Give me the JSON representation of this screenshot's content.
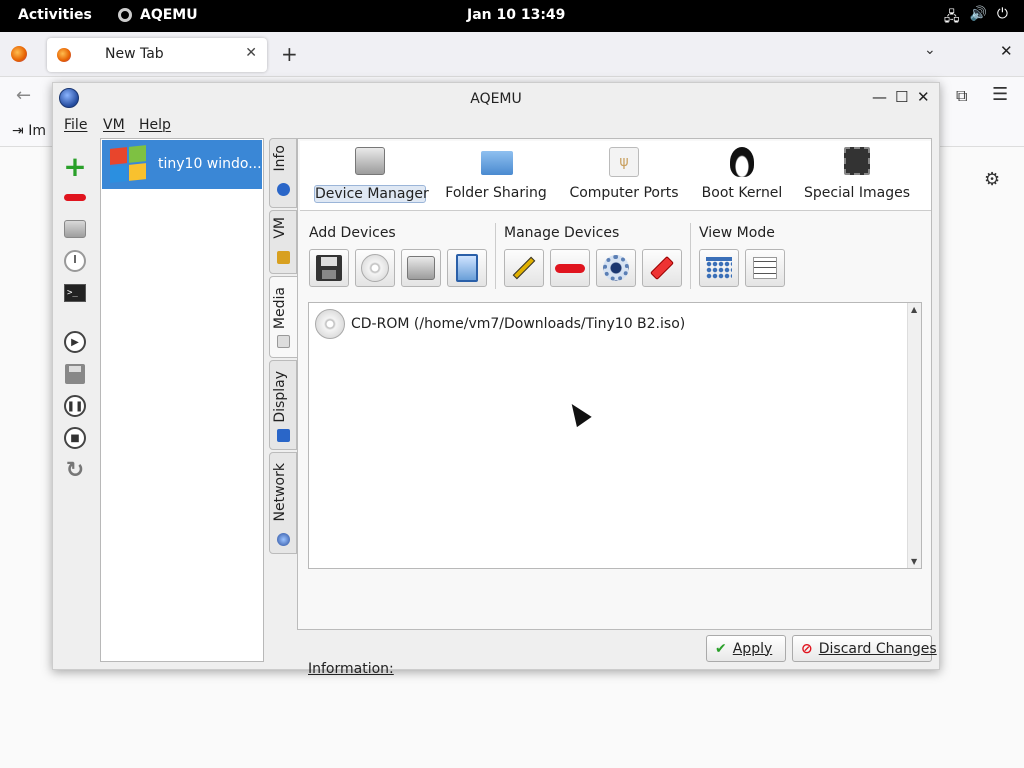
{
  "topbar": {
    "activities": "Activities",
    "app_name": "AQEMU",
    "clock": "Jan 10  13:49"
  },
  "firefox": {
    "tab_title": "New Tab",
    "bookmark_label": "Im"
  },
  "window": {
    "title": "AQEMU",
    "menu": [
      "File",
      "VM",
      "Help"
    ]
  },
  "vm_list": [
    {
      "name": "tiny10 windo..."
    }
  ],
  "vertical_tabs": [
    "Info",
    "VM",
    "Media",
    "Display",
    "Network"
  ],
  "categories": [
    {
      "label": "Device Manager"
    },
    {
      "label": "Folder Sharing"
    },
    {
      "label": "Computer Ports"
    },
    {
      "label": "Boot Kernel"
    },
    {
      "label": "Special Images"
    }
  ],
  "toolbar_groups": {
    "add": "Add Devices",
    "manage": "Manage Devices",
    "view": "View Mode"
  },
  "devices": [
    {
      "label": "CD-ROM (/home/vm7/Downloads/Tiny10 B2.iso)",
      "icon": "cdrom-icon"
    }
  ],
  "information_label": "Information:",
  "buttons": {
    "apply": "Apply",
    "discard": "Discard Changes"
  },
  "colors": {
    "selection": "#3a87d6",
    "add_green": "#2aa02a",
    "remove_red": "#e0141e"
  }
}
